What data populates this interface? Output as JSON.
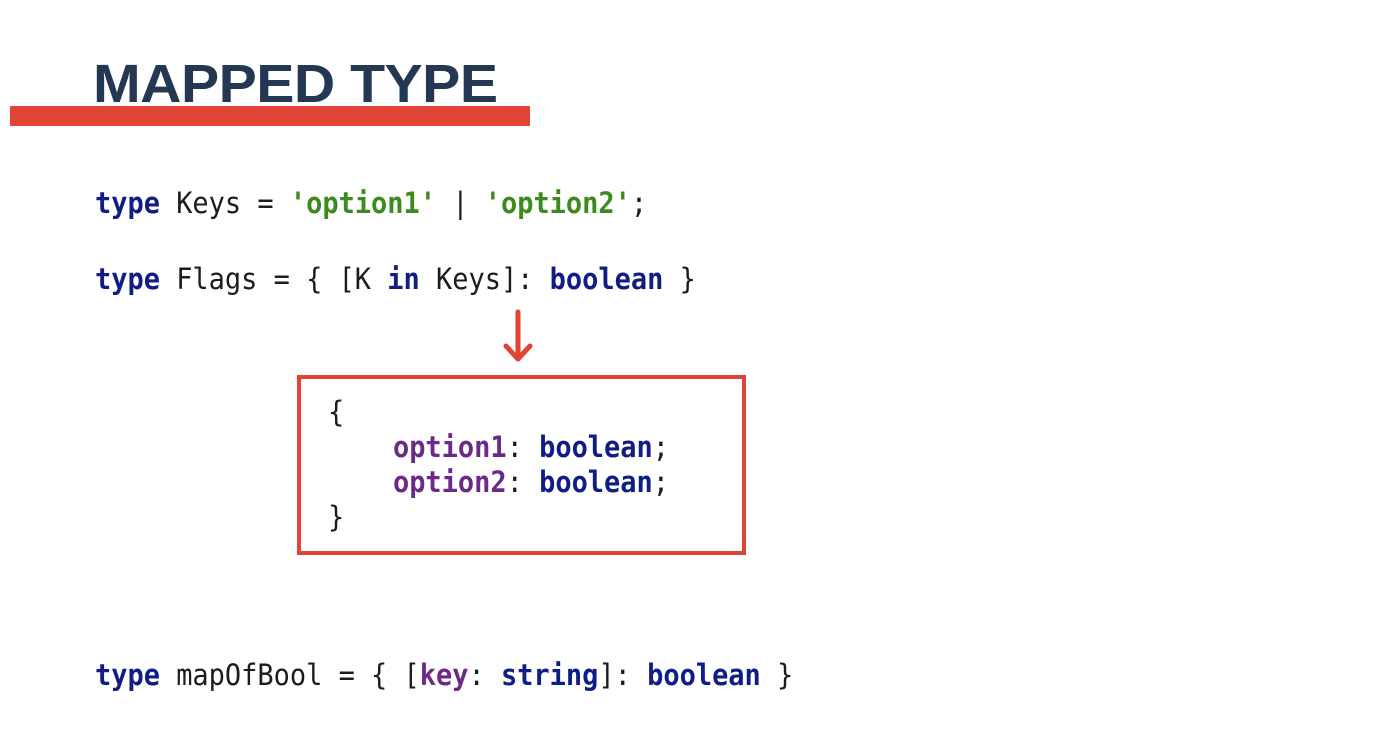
{
  "title": "MAPPED TYPE",
  "colors": {
    "title": "#243853",
    "accent": "#e04434",
    "keyword": "#101d85",
    "string": "#3d8a1f",
    "property": "#6b2a86",
    "text": "#1c1c1c"
  },
  "code": {
    "line1": {
      "kw_type": "type",
      "name": " Keys = ",
      "str1": "'option1'",
      "sep": " | ",
      "str2": "'option2'",
      "end": ";"
    },
    "line2": {
      "kw_type": "type",
      "name": " Flags = { [K ",
      "kw_in": "in",
      "rest": " Keys]: ",
      "kw_boolean": "boolean",
      "end": " }"
    },
    "result": {
      "open": "{",
      "indent": "    ",
      "prop1": "option1",
      "colon1": ": ",
      "type1": "boolean",
      "semi1": ";",
      "prop2": "option2",
      "colon2": ": ",
      "type2": "boolean",
      "semi2": ";",
      "close": "}"
    },
    "line3": {
      "kw_type": "type",
      "name": " mapOfBool = { [",
      "prop_key": "key",
      "colon": ": ",
      "kw_string": "string",
      "rest": "]: ",
      "kw_boolean": "boolean",
      "end": " }"
    }
  },
  "icons": {
    "arrow": "arrow-down-icon"
  }
}
